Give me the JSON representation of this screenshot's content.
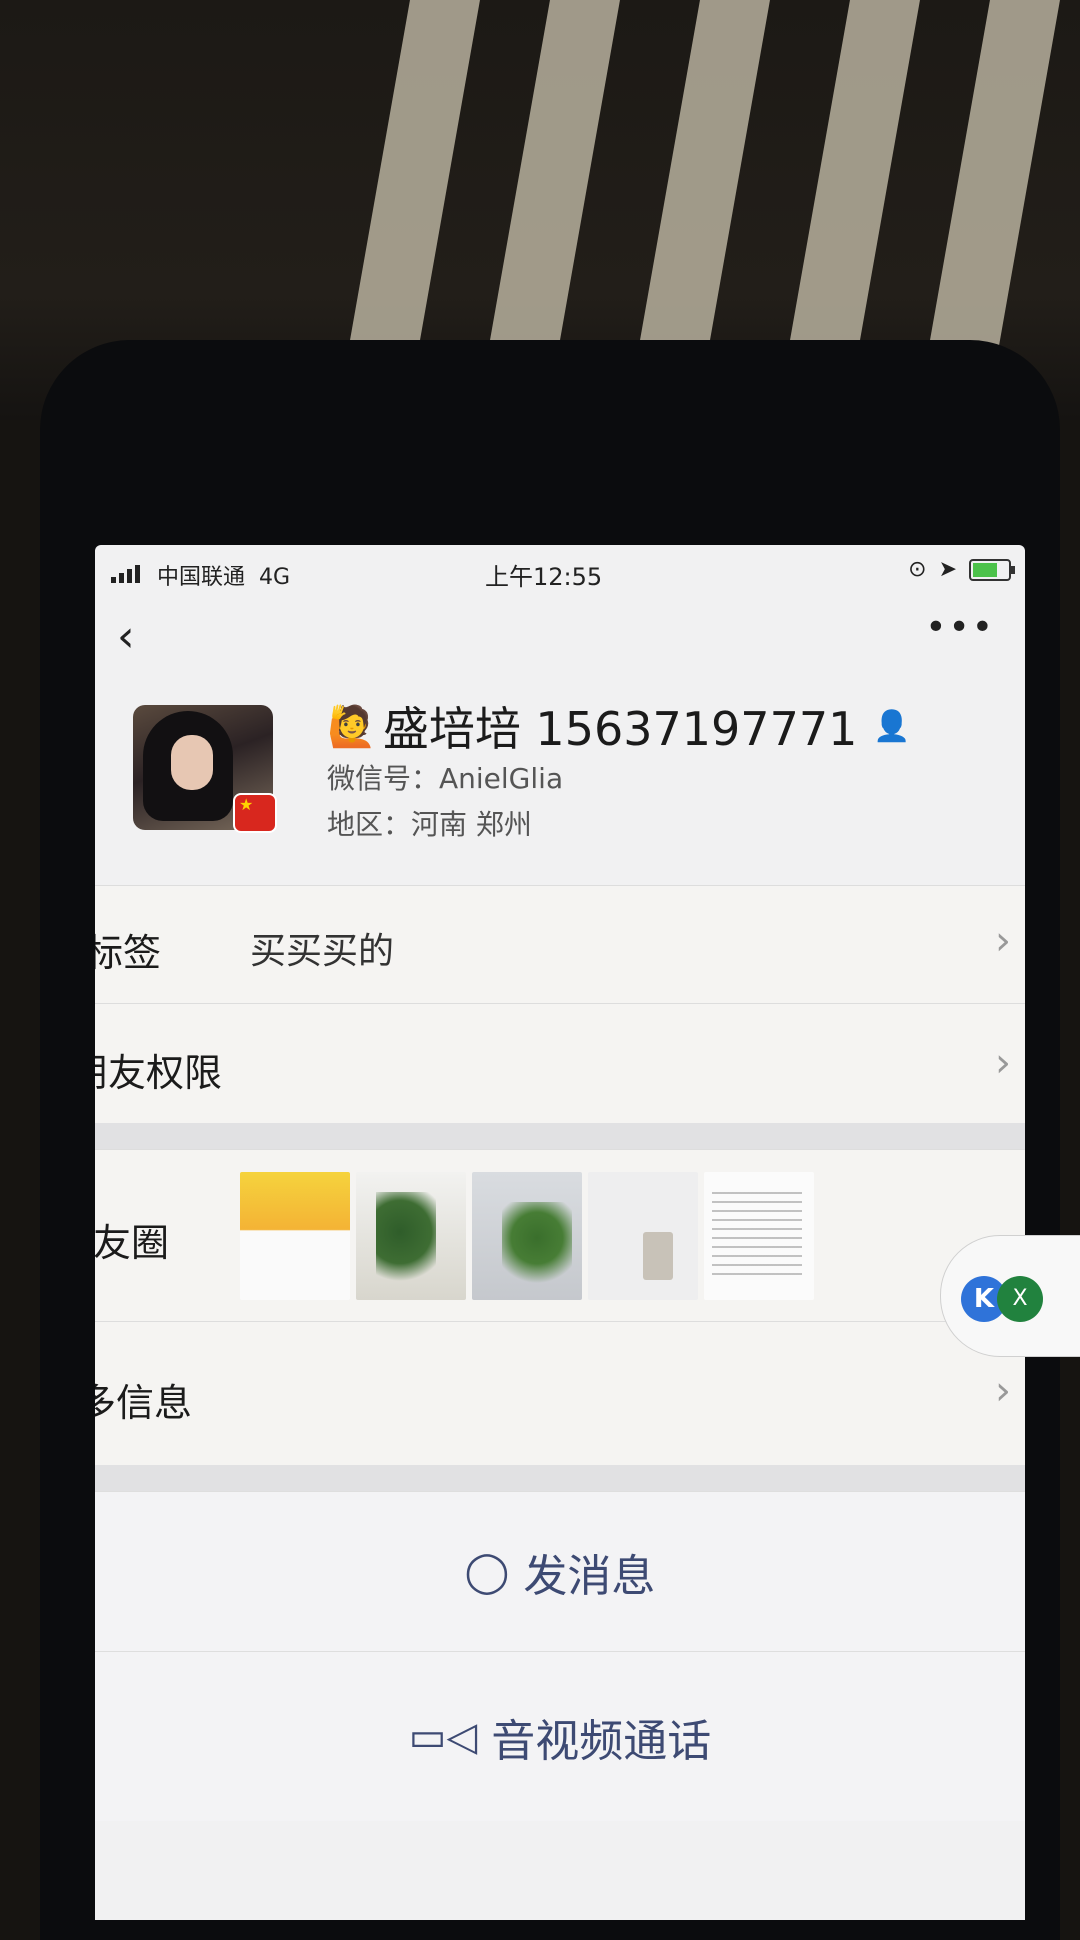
{
  "status_bar": {
    "carrier": "中国联通",
    "network": "4G",
    "time": "上午12:55"
  },
  "nav": {
    "back_icon": "chevron-left-icon",
    "more_label": "•••"
  },
  "profile": {
    "pose_emoji": "🙋",
    "name": "盛培培 15637197771",
    "gender_icon": "👤",
    "wechat_id": "微信号：AnielGlia",
    "region": "地区：河南 郑州",
    "flag_badge": "★"
  },
  "rows": {
    "tags_label": "标签",
    "tags_value": "买买买的",
    "permissions_label": "朋友权限",
    "moments_label": "朋友圈",
    "more_info_label": "更多信息"
  },
  "floating": {
    "bubble_a": "K",
    "bubble_b": "X"
  },
  "actions": {
    "message_label": "发消息",
    "call_label": "音视频通话"
  },
  "colors": {
    "accent_action": "#3d4a73",
    "flag_red": "#d8271e",
    "battery_green": "#4cc24a"
  }
}
